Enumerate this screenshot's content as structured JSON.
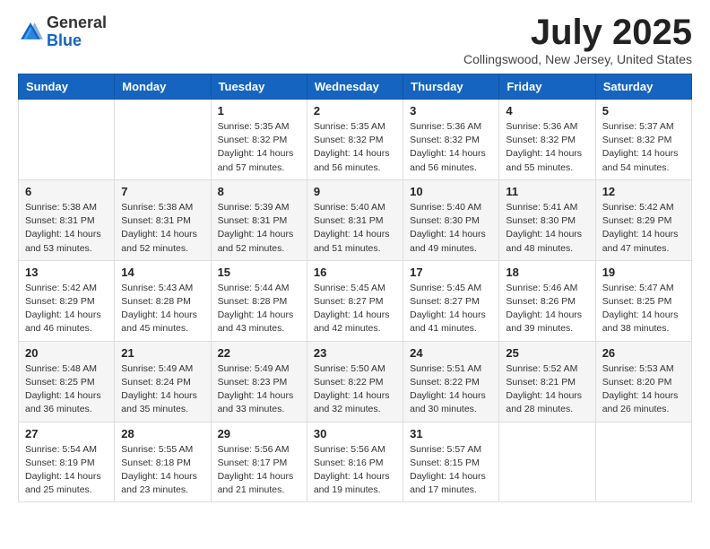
{
  "logo": {
    "general": "General",
    "blue": "Blue"
  },
  "header": {
    "month_title": "July 2025",
    "location": "Collingswood, New Jersey, United States"
  },
  "days_of_week": [
    "Sunday",
    "Monday",
    "Tuesday",
    "Wednesday",
    "Thursday",
    "Friday",
    "Saturday"
  ],
  "weeks": [
    [
      {
        "day": "",
        "sunrise": "",
        "sunset": "",
        "daylight": ""
      },
      {
        "day": "",
        "sunrise": "",
        "sunset": "",
        "daylight": ""
      },
      {
        "day": "1",
        "sunrise": "Sunrise: 5:35 AM",
        "sunset": "Sunset: 8:32 PM",
        "daylight": "Daylight: 14 hours and 57 minutes."
      },
      {
        "day": "2",
        "sunrise": "Sunrise: 5:35 AM",
        "sunset": "Sunset: 8:32 PM",
        "daylight": "Daylight: 14 hours and 56 minutes."
      },
      {
        "day": "3",
        "sunrise": "Sunrise: 5:36 AM",
        "sunset": "Sunset: 8:32 PM",
        "daylight": "Daylight: 14 hours and 56 minutes."
      },
      {
        "day": "4",
        "sunrise": "Sunrise: 5:36 AM",
        "sunset": "Sunset: 8:32 PM",
        "daylight": "Daylight: 14 hours and 55 minutes."
      },
      {
        "day": "5",
        "sunrise": "Sunrise: 5:37 AM",
        "sunset": "Sunset: 8:32 PM",
        "daylight": "Daylight: 14 hours and 54 minutes."
      }
    ],
    [
      {
        "day": "6",
        "sunrise": "Sunrise: 5:38 AM",
        "sunset": "Sunset: 8:31 PM",
        "daylight": "Daylight: 14 hours and 53 minutes."
      },
      {
        "day": "7",
        "sunrise": "Sunrise: 5:38 AM",
        "sunset": "Sunset: 8:31 PM",
        "daylight": "Daylight: 14 hours and 52 minutes."
      },
      {
        "day": "8",
        "sunrise": "Sunrise: 5:39 AM",
        "sunset": "Sunset: 8:31 PM",
        "daylight": "Daylight: 14 hours and 52 minutes."
      },
      {
        "day": "9",
        "sunrise": "Sunrise: 5:40 AM",
        "sunset": "Sunset: 8:31 PM",
        "daylight": "Daylight: 14 hours and 51 minutes."
      },
      {
        "day": "10",
        "sunrise": "Sunrise: 5:40 AM",
        "sunset": "Sunset: 8:30 PM",
        "daylight": "Daylight: 14 hours and 49 minutes."
      },
      {
        "day": "11",
        "sunrise": "Sunrise: 5:41 AM",
        "sunset": "Sunset: 8:30 PM",
        "daylight": "Daylight: 14 hours and 48 minutes."
      },
      {
        "day": "12",
        "sunrise": "Sunrise: 5:42 AM",
        "sunset": "Sunset: 8:29 PM",
        "daylight": "Daylight: 14 hours and 47 minutes."
      }
    ],
    [
      {
        "day": "13",
        "sunrise": "Sunrise: 5:42 AM",
        "sunset": "Sunset: 8:29 PM",
        "daylight": "Daylight: 14 hours and 46 minutes."
      },
      {
        "day": "14",
        "sunrise": "Sunrise: 5:43 AM",
        "sunset": "Sunset: 8:28 PM",
        "daylight": "Daylight: 14 hours and 45 minutes."
      },
      {
        "day": "15",
        "sunrise": "Sunrise: 5:44 AM",
        "sunset": "Sunset: 8:28 PM",
        "daylight": "Daylight: 14 hours and 43 minutes."
      },
      {
        "day": "16",
        "sunrise": "Sunrise: 5:45 AM",
        "sunset": "Sunset: 8:27 PM",
        "daylight": "Daylight: 14 hours and 42 minutes."
      },
      {
        "day": "17",
        "sunrise": "Sunrise: 5:45 AM",
        "sunset": "Sunset: 8:27 PM",
        "daylight": "Daylight: 14 hours and 41 minutes."
      },
      {
        "day": "18",
        "sunrise": "Sunrise: 5:46 AM",
        "sunset": "Sunset: 8:26 PM",
        "daylight": "Daylight: 14 hours and 39 minutes."
      },
      {
        "day": "19",
        "sunrise": "Sunrise: 5:47 AM",
        "sunset": "Sunset: 8:25 PM",
        "daylight": "Daylight: 14 hours and 38 minutes."
      }
    ],
    [
      {
        "day": "20",
        "sunrise": "Sunrise: 5:48 AM",
        "sunset": "Sunset: 8:25 PM",
        "daylight": "Daylight: 14 hours and 36 minutes."
      },
      {
        "day": "21",
        "sunrise": "Sunrise: 5:49 AM",
        "sunset": "Sunset: 8:24 PM",
        "daylight": "Daylight: 14 hours and 35 minutes."
      },
      {
        "day": "22",
        "sunrise": "Sunrise: 5:49 AM",
        "sunset": "Sunset: 8:23 PM",
        "daylight": "Daylight: 14 hours and 33 minutes."
      },
      {
        "day": "23",
        "sunrise": "Sunrise: 5:50 AM",
        "sunset": "Sunset: 8:22 PM",
        "daylight": "Daylight: 14 hours and 32 minutes."
      },
      {
        "day": "24",
        "sunrise": "Sunrise: 5:51 AM",
        "sunset": "Sunset: 8:22 PM",
        "daylight": "Daylight: 14 hours and 30 minutes."
      },
      {
        "day": "25",
        "sunrise": "Sunrise: 5:52 AM",
        "sunset": "Sunset: 8:21 PM",
        "daylight": "Daylight: 14 hours and 28 minutes."
      },
      {
        "day": "26",
        "sunrise": "Sunrise: 5:53 AM",
        "sunset": "Sunset: 8:20 PM",
        "daylight": "Daylight: 14 hours and 26 minutes."
      }
    ],
    [
      {
        "day": "27",
        "sunrise": "Sunrise: 5:54 AM",
        "sunset": "Sunset: 8:19 PM",
        "daylight": "Daylight: 14 hours and 25 minutes."
      },
      {
        "day": "28",
        "sunrise": "Sunrise: 5:55 AM",
        "sunset": "Sunset: 8:18 PM",
        "daylight": "Daylight: 14 hours and 23 minutes."
      },
      {
        "day": "29",
        "sunrise": "Sunrise: 5:56 AM",
        "sunset": "Sunset: 8:17 PM",
        "daylight": "Daylight: 14 hours and 21 minutes."
      },
      {
        "day": "30",
        "sunrise": "Sunrise: 5:56 AM",
        "sunset": "Sunset: 8:16 PM",
        "daylight": "Daylight: 14 hours and 19 minutes."
      },
      {
        "day": "31",
        "sunrise": "Sunrise: 5:57 AM",
        "sunset": "Sunset: 8:15 PM",
        "daylight": "Daylight: 14 hours and 17 minutes."
      },
      {
        "day": "",
        "sunrise": "",
        "sunset": "",
        "daylight": ""
      },
      {
        "day": "",
        "sunrise": "",
        "sunset": "",
        "daylight": ""
      }
    ]
  ]
}
